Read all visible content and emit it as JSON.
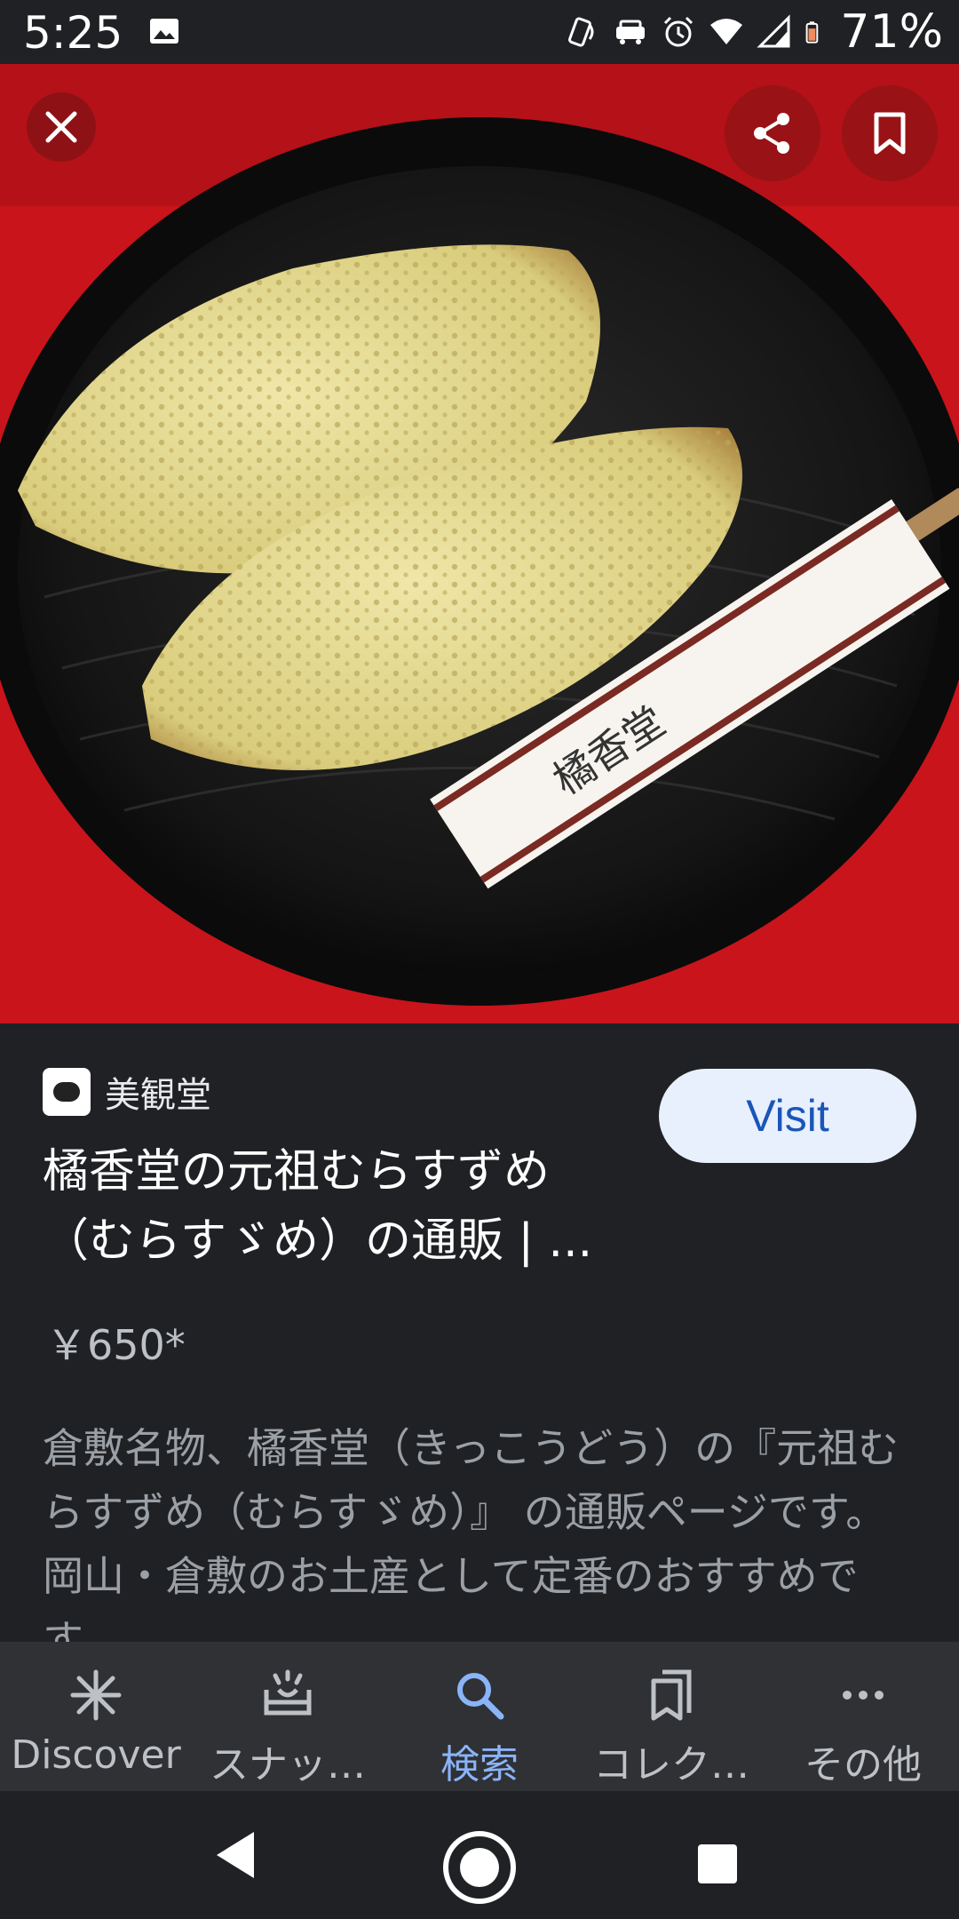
{
  "status_bar": {
    "time": "5:25",
    "battery_percent": "71%",
    "icons": [
      "image-icon",
      "nfc-icon",
      "car-mode-icon",
      "alarm-icon",
      "wifi-icon",
      "signal-icon",
      "battery-icon"
    ]
  },
  "image_viewer": {
    "controls": [
      "close-icon",
      "share-icon",
      "bookmark-icon"
    ]
  },
  "result": {
    "source_name": "美観堂",
    "visit_label": "Visit",
    "title_line1": "橘香堂の元祖むらすずめ",
    "title_line2": "（むらすゞめ）の通販 | ...",
    "price": "￥650*",
    "description": "倉敷名物、橘香堂（きっこうどう）の『元祖むらすずめ（むらすゞめ）』 の通販ページです。岡山・倉敷のお土産として定番のおすすめです。"
  },
  "bottom_nav": {
    "items": [
      {
        "label": "Discover",
        "icon": "discover-icon",
        "active": false
      },
      {
        "label": "スナッ…",
        "icon": "snapshot-icon",
        "active": false
      },
      {
        "label": "検索",
        "icon": "search-icon",
        "active": true
      },
      {
        "label": "コレク…",
        "icon": "collections-icon",
        "active": false
      },
      {
        "label": "その他",
        "icon": "more-icon",
        "active": false
      }
    ]
  },
  "colors": {
    "background": "#202124",
    "nav_background": "#303134",
    "accent": "#8ab4f8",
    "visit_bg": "#e8f0fe",
    "visit_text": "#1a56b8"
  }
}
